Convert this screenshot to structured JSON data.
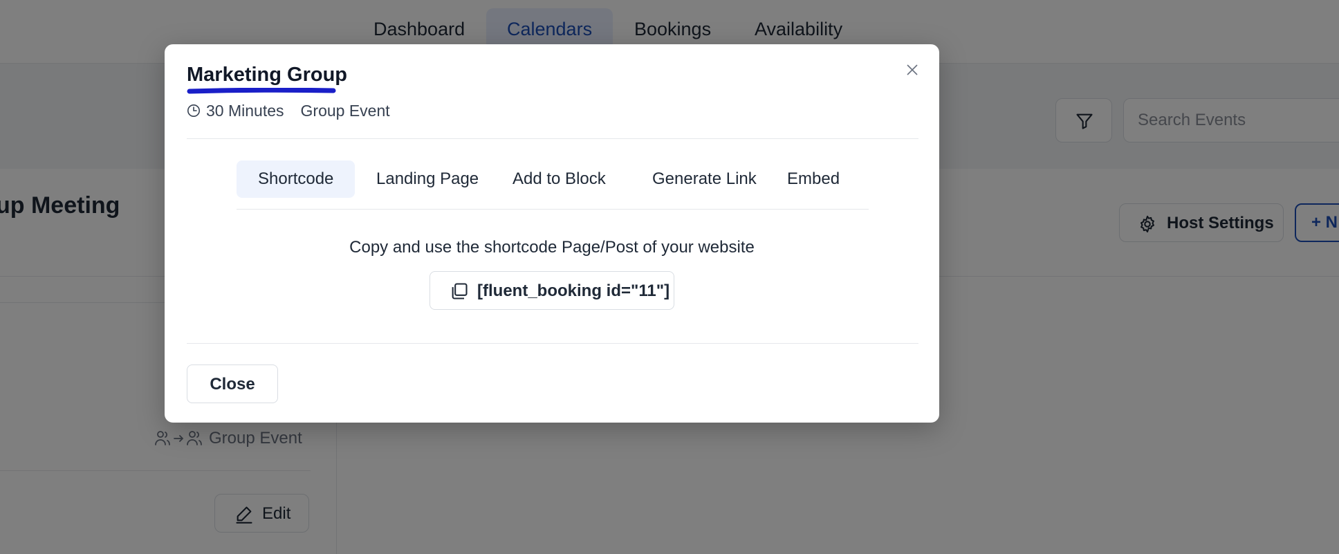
{
  "nav": {
    "tabs": [
      {
        "label": "Dashboard",
        "active": false
      },
      {
        "label": "Calendars",
        "active": true
      },
      {
        "label": "Bookings",
        "active": false
      },
      {
        "label": "Availability",
        "active": false
      }
    ]
  },
  "toolbar": {
    "filter_icon": "filter-icon",
    "search_placeholder": "Search Events"
  },
  "calendar": {
    "event_title": "up Meeting",
    "host_settings_label": "Host Settings",
    "new_button_label": "+ N",
    "event_type_label": "Group Event",
    "edit_label": "Edit"
  },
  "modal": {
    "title": "Marketing Group",
    "duration": "30 Minutes",
    "event_type": "Group Event",
    "tabs": [
      {
        "label": "Shortcode",
        "active": true
      },
      {
        "label": "Landing Page",
        "active": false
      },
      {
        "label": "Add to Block",
        "active": false
      },
      {
        "label": "Generate Link",
        "active": false
      },
      {
        "label": "Embed",
        "active": false
      }
    ],
    "instruction": "Copy and use the shortcode Page/Post of your website",
    "shortcode": "[fluent_booking id=\"11\"]",
    "close_label": "Close"
  },
  "colors": {
    "accent": "#1d4fb8",
    "title_underline": "#1a1fc8",
    "active_tab_bg": "#eef3fd"
  }
}
